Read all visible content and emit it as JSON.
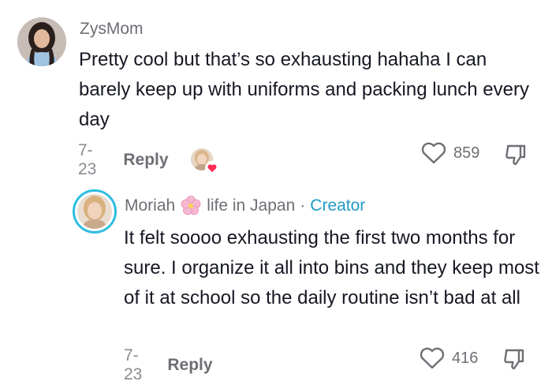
{
  "comments": [
    {
      "username": "ZysMom",
      "text": "Pretty cool but that’s so exhausting hahaha I can barely keep up with uniforms and packing lunch every day",
      "date": "7-23",
      "reply_label": "Reply",
      "likes": "859",
      "avatar_icon": "user-avatar",
      "creator_liked_icon": "creator-liked-avatar",
      "like_icon": "heart-outline-icon",
      "dislike_icon": "thumbs-down-icon"
    },
    {
      "username_part1": "Moriah",
      "username_emoji": "cherry-blossom-icon",
      "username_part2": "life in Japan",
      "separator": "·",
      "creator_label": "Creator",
      "text": "It felt soooo exhausting the first two months for sure. I organize it all into bins and they keep most of it at school so the daily routine isn’t bad at all",
      "date": "7-23",
      "reply_label": "Reply",
      "likes": "416",
      "avatar_icon": "creator-avatar",
      "like_icon": "heart-outline-icon",
      "dislike_icon": "thumbs-down-icon"
    }
  ],
  "colors": {
    "text": "#161823",
    "muted": "#6e6f75",
    "date": "#8a8b91",
    "creator": "#1e9bc7",
    "avatar_ring": "#2dbde0",
    "heart_badge": "#fe2c55"
  }
}
